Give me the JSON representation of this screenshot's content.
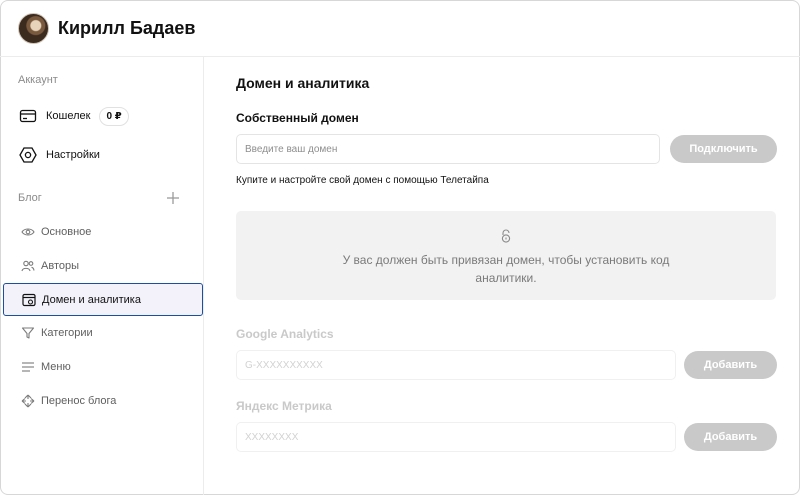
{
  "user": {
    "name": "Кирилл Бадаев"
  },
  "sidebar": {
    "account_label": "Аккаунт",
    "wallet": {
      "label": "Кошелек",
      "balance": "0 ₽"
    },
    "settings_label": "Настройки",
    "blog_label": "Блог",
    "items": [
      {
        "label": "Основное",
        "icon": "eye-icon"
      },
      {
        "label": "Авторы",
        "icon": "users-icon"
      },
      {
        "label": "Домен и аналитика",
        "icon": "domain-icon",
        "active": true
      },
      {
        "label": "Категории",
        "icon": "categories-icon"
      },
      {
        "label": "Меню",
        "icon": "menu-icon"
      },
      {
        "label": "Перенос блога",
        "icon": "transfer-icon"
      }
    ]
  },
  "main": {
    "title": "Домен и аналитика",
    "own_domain": {
      "title": "Собственный домен",
      "placeholder": "Введите ваш домен",
      "connect_label": "Подключить",
      "hint": "Купите и настройте свой домен с помощью Телетайпа"
    },
    "notice": "У вас должен быть привязан домен, чтобы установить код аналитики.",
    "google_analytics": {
      "label": "Google Analytics",
      "placeholder": "G-XXXXXXXXXX",
      "button_label": "Добавить"
    },
    "yandex_metrika": {
      "label": "Яндекс Метрика",
      "placeholder": "XXXXXXXX",
      "button_label": "Добавить"
    }
  },
  "colors": {
    "accent": "#1b4fa0",
    "button_disabled": "#c9c9c9",
    "active_bg": "#f3f2fb"
  }
}
